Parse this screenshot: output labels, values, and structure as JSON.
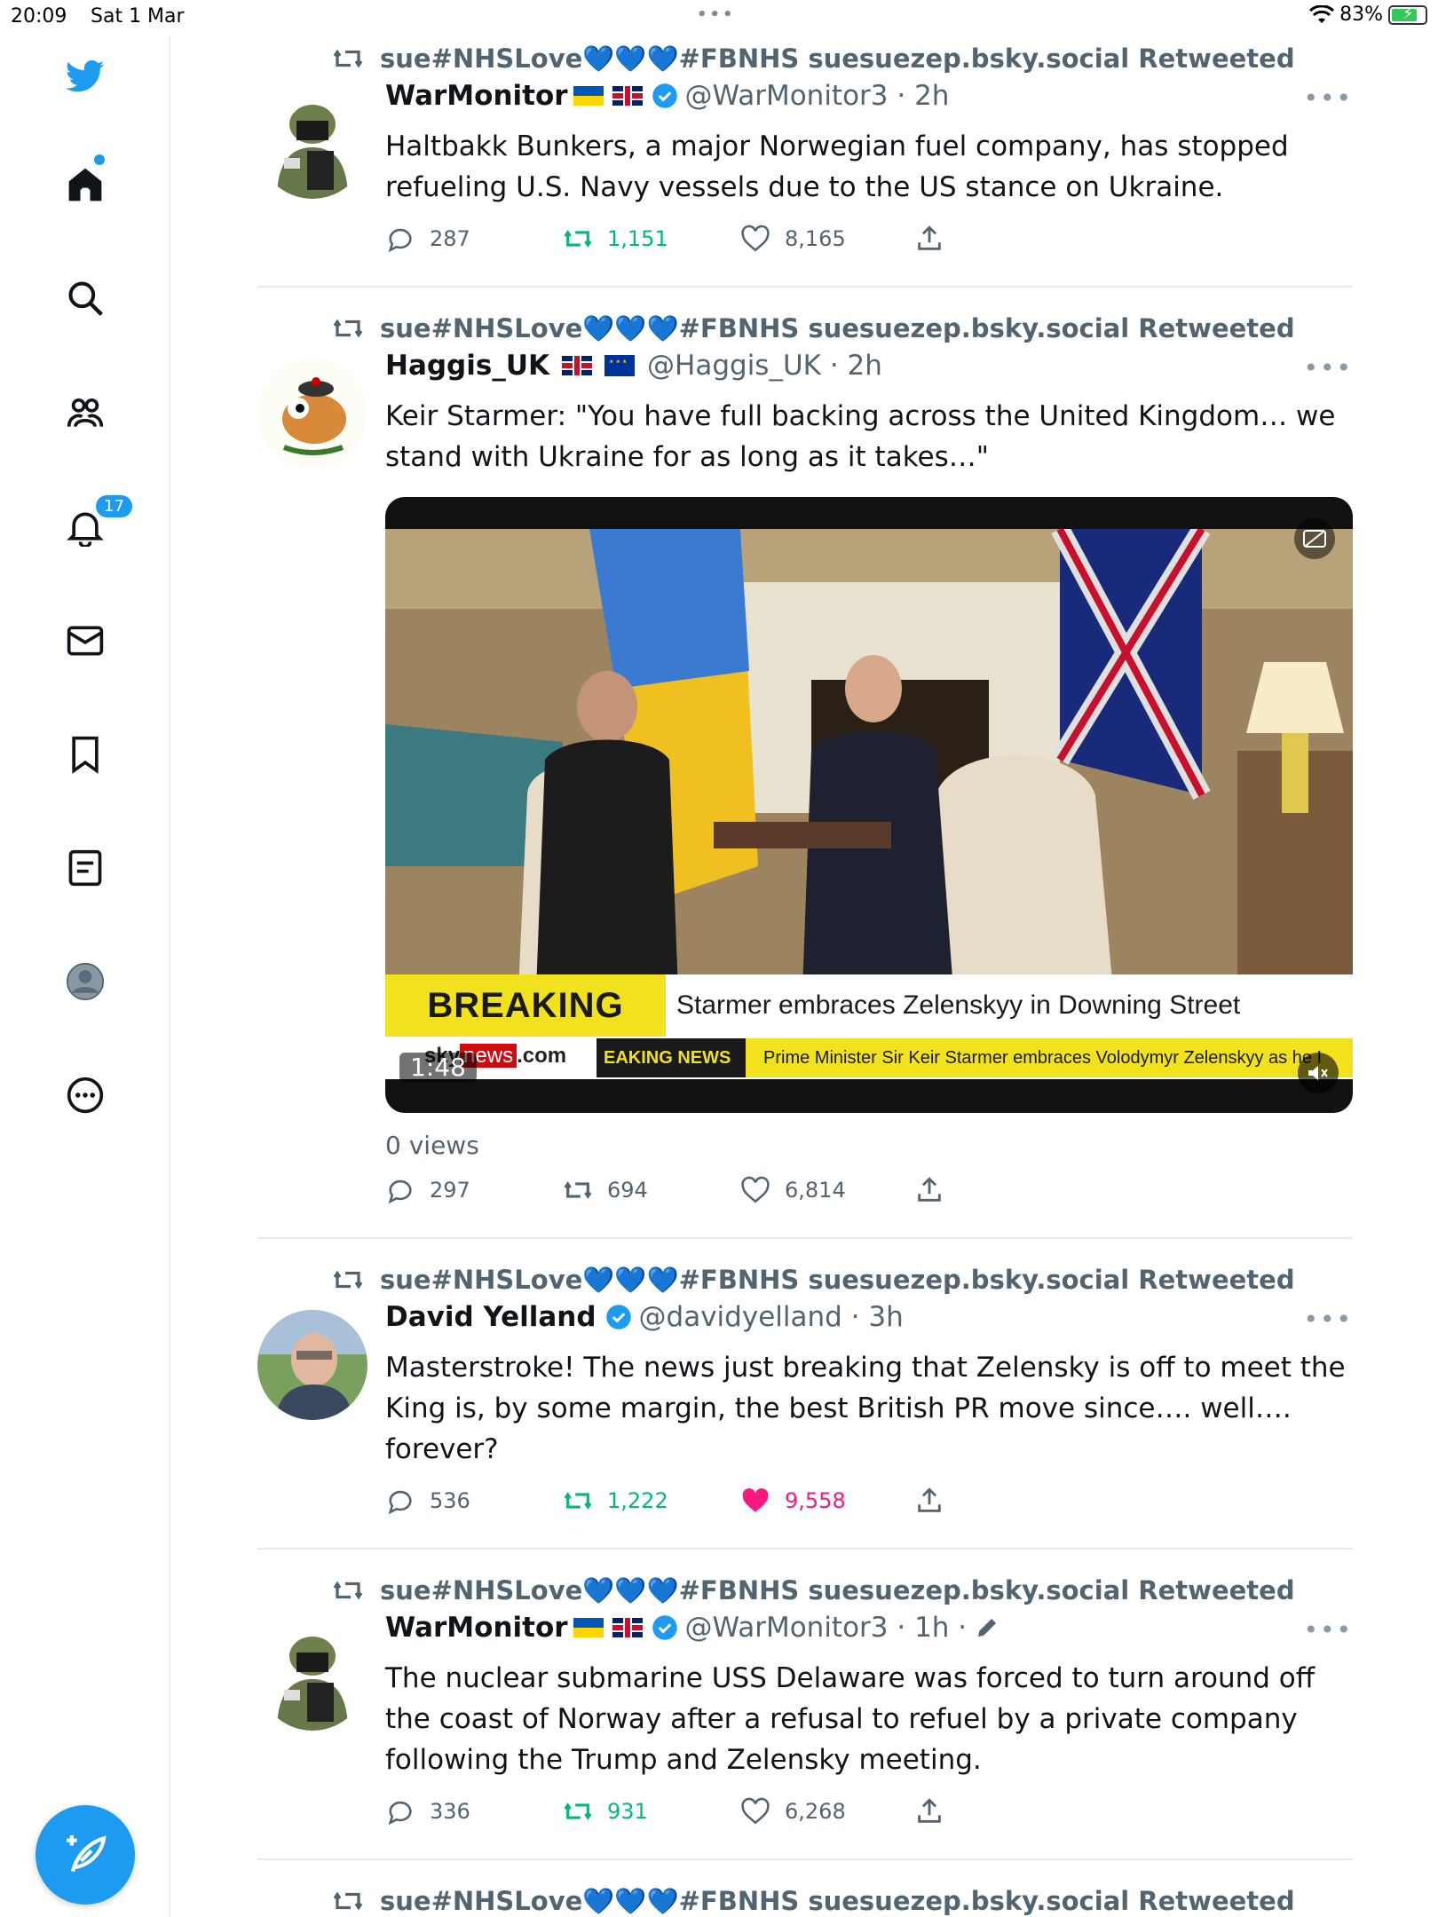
{
  "status_bar": {
    "time": "20:09",
    "date": "Sat 1 Mar",
    "battery": "83%"
  },
  "sidebar": {
    "items": [
      {
        "name": "logo",
        "icon": "twitter-bird-icon"
      },
      {
        "name": "home",
        "icon": "home-icon"
      },
      {
        "name": "explore",
        "icon": "search-icon"
      },
      {
        "name": "communities",
        "icon": "communities-icon"
      },
      {
        "name": "notifications",
        "icon": "bell-icon",
        "badge": "17"
      },
      {
        "name": "messages",
        "icon": "mail-icon"
      },
      {
        "name": "bookmarks",
        "icon": "bookmark-icon"
      },
      {
        "name": "lists",
        "icon": "list-icon"
      },
      {
        "name": "profile",
        "icon": "avatar-icon"
      },
      {
        "name": "more",
        "icon": "more-circle-icon"
      }
    ],
    "compose_icon": "compose-icon"
  },
  "colors": {
    "accent": "#1d9bf0",
    "retweet": "#00ba7c",
    "like": "#f91880",
    "muted": "#536471"
  },
  "tweets": [
    {
      "retweeted_by": "sue#NHSLove💙💙💙#FBNHS suesuezep.bsky.social Retweeted",
      "name": "WarMonitor",
      "handle_time": "@WarMonitor3 · 2h",
      "text": "Haltbakk Bunkers, a major Norwegian fuel company, has stopped refueling U.S. Navy vessels due to the US stance on Ukraine.",
      "replies": "287",
      "retweets": "1,151",
      "likes": "8,165",
      "retweeted": true,
      "liked": false
    },
    {
      "retweeted_by": "sue#NHSLove💙💙💙#FBNHS suesuezep.bsky.social Retweeted",
      "name": "Haggis_UK",
      "handle_time": "@Haggis_UK · 2h",
      "text": "Keir Starmer: \"You have full backing across the United Kingdom… we stand with Ukraine for as long as it takes…\"",
      "video": {
        "breaking": "BREAKING NEWS",
        "headline": "Starmer embraces Zelenskyy in Downing Street",
        "sky": "sky",
        "sky_news": "news",
        "sky_com": ".com",
        "ticker_label": "EAKING NEWS",
        "ticker_text": "Prime Minister Sir Keir Starmer embraces Volodymyr Zelenskyy as he I",
        "duration": "1:48"
      },
      "views": "0 views",
      "replies": "297",
      "retweets": "694",
      "likes": "6,814",
      "retweeted": false,
      "liked": false
    },
    {
      "retweeted_by": "sue#NHSLove💙💙💙#FBNHS suesuezep.bsky.social Retweeted",
      "name": "David Yelland",
      "handle_time": "@davidyelland · 3h",
      "text": "Masterstroke! The news just breaking that Zelensky is off to meet the King is, by some margin, the best British PR move since…. well…. forever?",
      "replies": "536",
      "retweets": "1,222",
      "likes": "9,558",
      "retweeted": true,
      "liked": true
    },
    {
      "retweeted_by": "sue#NHSLove💙💙💙#FBNHS suesuezep.bsky.social Retweeted",
      "name": "WarMonitor",
      "handle_time": "@WarMonitor3 · 1h ·",
      "text": "The nuclear submarine USS Delaware was forced to turn around off the coast of Norway after a refusal to refuel by a private company following the Trump and Zelensky meeting.",
      "replies": "336",
      "retweets": "931",
      "likes": "6,268",
      "retweeted": true,
      "liked": false
    },
    {
      "retweeted_by": "sue#NHSLove💙💙💙#FBNHS suesuezep.bsky.social Retweeted"
    }
  ]
}
